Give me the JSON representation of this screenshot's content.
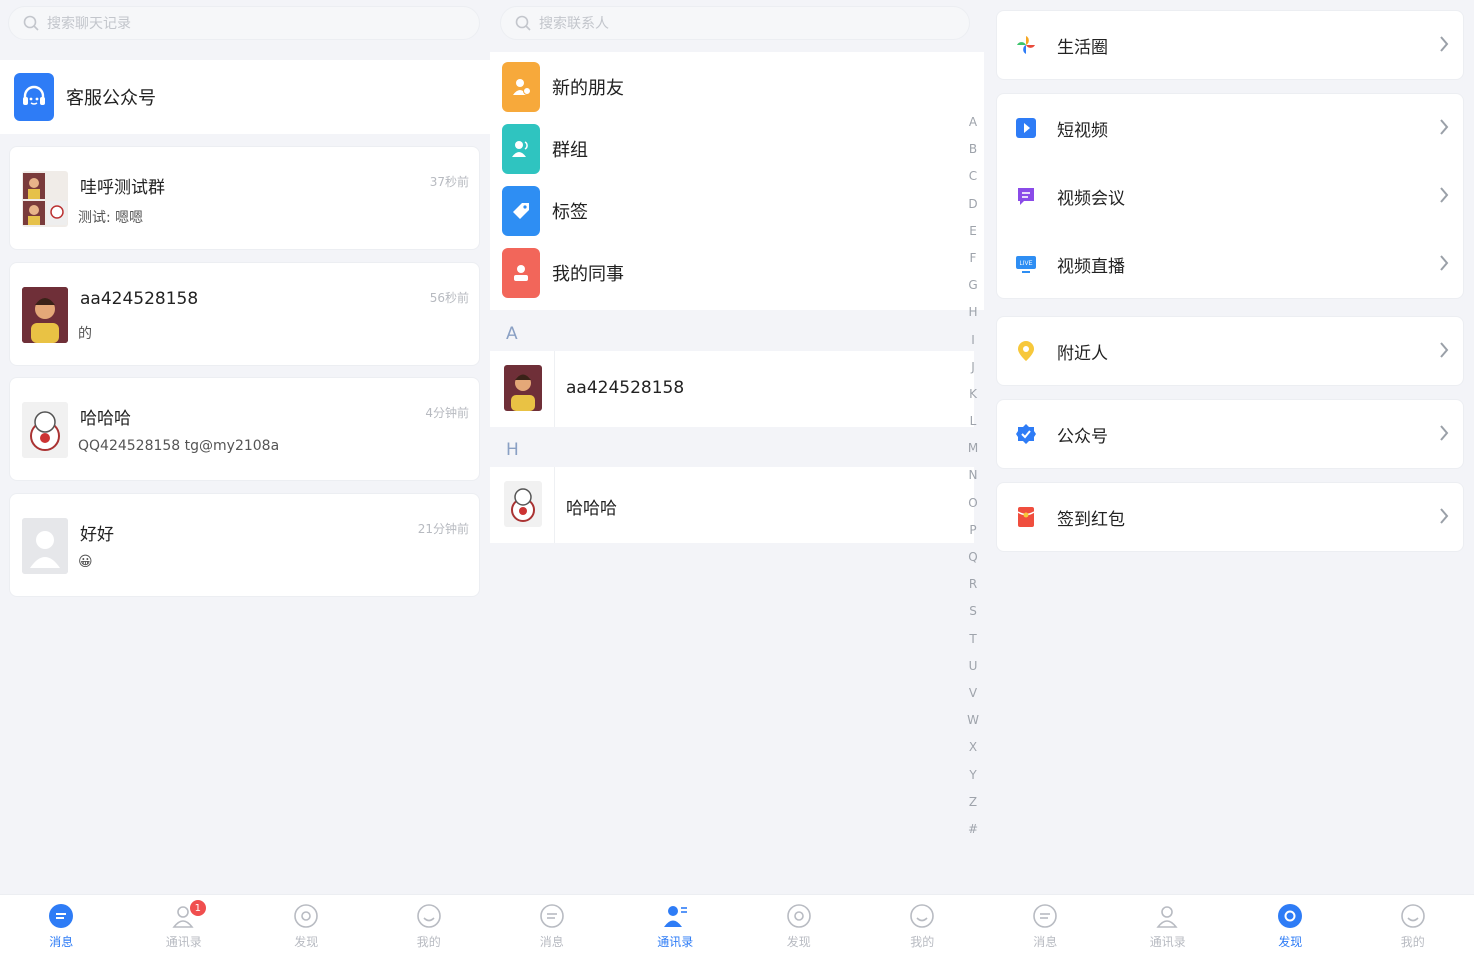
{
  "colors": {
    "accent": "#2e7cf6",
    "badge": "#f04e4e",
    "inactive_tab": "#b8bbc2"
  },
  "panel1": {
    "search_placeholder": "搜索聊天记录",
    "service": {
      "label": "客服公众号",
      "icon": "headset-icon"
    },
    "chats": [
      {
        "name": "哇呼测试群",
        "preview": "测试: 嗯嗯",
        "time": "37秒前",
        "avatar": "group-avatar"
      },
      {
        "name": "aa424528158",
        "preview": "的",
        "time": "56秒前",
        "avatar": "person-avatar"
      },
      {
        "name": "哈哈哈",
        "preview": "QQ424528158 tg@my2108a",
        "time": "4分钟前",
        "avatar": "lucky-cat-avatar"
      },
      {
        "name": "好好",
        "preview": "😀",
        "time": "21分钟前",
        "avatar": "default-avatar"
      }
    ],
    "tabs": [
      {
        "label": "消息",
        "icon": "message-icon",
        "active": true
      },
      {
        "label": "通讯录",
        "icon": "contacts-icon",
        "badge": "1"
      },
      {
        "label": "发现",
        "icon": "discover-icon"
      },
      {
        "label": "我的",
        "icon": "profile-icon"
      }
    ]
  },
  "panel2": {
    "search_placeholder": "搜索联系人",
    "entries": [
      {
        "label": "新的朋友",
        "icon": "new-friend-icon",
        "color": "#f7a93b"
      },
      {
        "label": "群组",
        "icon": "group-icon",
        "color": "#2fc4c0"
      },
      {
        "label": "标签",
        "icon": "tag-icon",
        "color": "#2e8ef3"
      },
      {
        "label": "我的同事",
        "icon": "colleague-icon",
        "color": "#f2665a"
      }
    ],
    "sections": [
      {
        "letter": "A",
        "contact": "aa424528158"
      },
      {
        "letter": "H",
        "contact": "哈哈哈"
      }
    ],
    "alphabet": [
      "A",
      "B",
      "C",
      "D",
      "E",
      "F",
      "G",
      "H",
      "I",
      "J",
      "K",
      "L",
      "M",
      "N",
      "O",
      "P",
      "Q",
      "R",
      "S",
      "T",
      "U",
      "V",
      "W",
      "X",
      "Y",
      "Z",
      "#"
    ],
    "tabs": [
      {
        "label": "消息",
        "icon": "message-icon"
      },
      {
        "label": "通讯录",
        "icon": "contacts-icon",
        "active": true
      },
      {
        "label": "发现",
        "icon": "discover-icon"
      },
      {
        "label": "我的",
        "icon": "profile-icon"
      }
    ]
  },
  "panel3": {
    "cards": [
      [
        {
          "label": "生活圈",
          "icon": "pinwheel-icon"
        }
      ],
      [
        {
          "label": "短视频",
          "icon": "play-icon"
        },
        {
          "label": "视频会议",
          "icon": "meeting-icon"
        },
        {
          "label": "视频直播",
          "icon": "live-icon",
          "icon_text": "LIVE"
        }
      ],
      [
        {
          "label": "附近人",
          "icon": "location-icon"
        }
      ],
      [
        {
          "label": "公众号",
          "icon": "verified-icon"
        }
      ],
      [
        {
          "label": "签到红包",
          "icon": "red-packet-icon"
        }
      ]
    ],
    "tabs": [
      {
        "label": "消息",
        "icon": "message-icon"
      },
      {
        "label": "通讯录",
        "icon": "contacts-icon"
      },
      {
        "label": "发现",
        "icon": "discover-icon",
        "active": true
      },
      {
        "label": "我的",
        "icon": "profile-icon"
      }
    ]
  }
}
